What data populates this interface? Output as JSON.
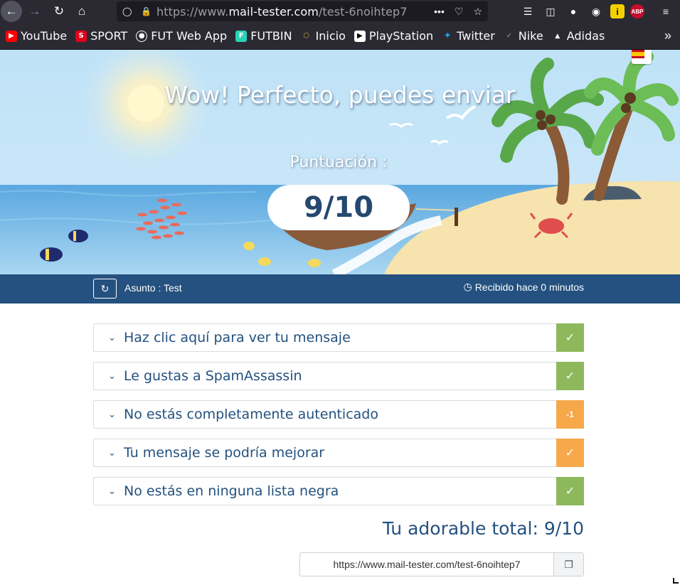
{
  "browser": {
    "url_prefix": "https://www.",
    "url_domain": "mail-tester.com",
    "url_path": "/test-6noihtep7",
    "more_dots": "•••",
    "bookmarks": [
      {
        "label": "YouTube",
        "icon": "youtube-icon",
        "color": "#ff0000"
      },
      {
        "label": "SPORT",
        "icon": "sport-icon",
        "color": "#e2001a"
      },
      {
        "label": "FUT Web App",
        "icon": "globe-icon",
        "color": "#fbfbfe"
      },
      {
        "label": "FUTBIN",
        "icon": "futbin-icon",
        "color": "#2bd1b6"
      },
      {
        "label": "Inicio",
        "icon": "inicio-icon",
        "color": "#c8a24a"
      },
      {
        "label": "PlayStation",
        "icon": "playstation-icon",
        "color": "#ffffff"
      },
      {
        "label": "Twitter",
        "icon": "twitter-icon",
        "color": "#1da1f2"
      },
      {
        "label": "Nike",
        "icon": "nike-icon",
        "color": "#ffffff"
      },
      {
        "label": "Adidas",
        "icon": "adidas-icon",
        "color": "#ffffff"
      }
    ],
    "ext_yellow_letter": "i",
    "abp_label": "ABP"
  },
  "hero": {
    "title": "Wow! Perfecto, puedes enviar",
    "score_label": "Puntuación :",
    "score": "9/10"
  },
  "subject": {
    "text": "Asunto : Test",
    "received": "Recibido hace 0 minutos"
  },
  "results": [
    {
      "label": "Haz clic aquí para ver tu mensaje",
      "status": "✓",
      "state": "ok"
    },
    {
      "label": "Le gustas a SpamAssassin",
      "status": "✓",
      "state": "ok"
    },
    {
      "label": "No estás completamente autenticado",
      "status": "-1",
      "state": "warn"
    },
    {
      "label": "Tu mensaje se podría mejorar",
      "status": "✓",
      "state": "warn"
    },
    {
      "label": "No estás en ninguna lista negra",
      "status": "✓",
      "state": "ok"
    }
  ],
  "total": "Tu adorable total: 9/10",
  "share_url": "https://www.mail-tester.com/test-6noihtep7",
  "colors": {
    "ok": "#8db85c",
    "warn": "#f6a84a",
    "brand": "#24517f"
  }
}
